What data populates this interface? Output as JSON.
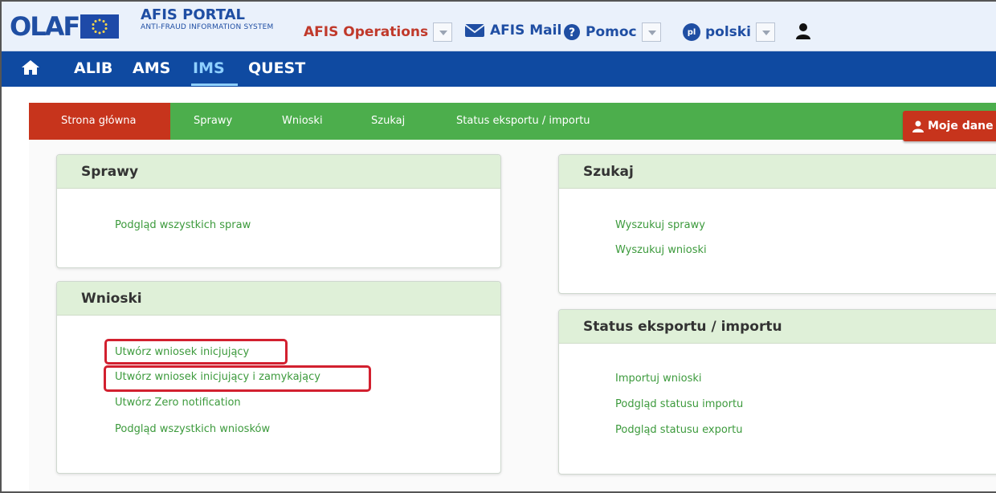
{
  "header": {
    "logo": "OLAF",
    "portal_title": "AFIS PORTAL",
    "portal_subtitle": "ANTI-FRAUD INFORMATION SYSTEM",
    "operations_label": "AFIS Operations",
    "mail_label": "AFIS Mail",
    "help_label": "Pomoc",
    "language_code": "pl",
    "language_label": "polski"
  },
  "app_nav": {
    "items": [
      "ALIB",
      "AMS",
      "IMS",
      "QUEST"
    ],
    "active": "IMS"
  },
  "module_nav": {
    "tabs": [
      "Strona główna",
      "Sprawy",
      "Wnioski",
      "Szukaj",
      "Status eksportu / importu"
    ],
    "active": "Strona główna",
    "user_button": "Moje dane"
  },
  "panels": {
    "sprawy": {
      "title": "Sprawy",
      "links": [
        "Podgląd wszystkich spraw"
      ]
    },
    "wnioski": {
      "title": "Wnioski",
      "links": [
        "Utwórz wniosek inicjujący",
        "Utwórz wniosek inicjujący i zamykający",
        "Utwórz Zero notification",
        "Podgląd wszystkich wniosków"
      ]
    },
    "szukaj": {
      "title": "Szukaj",
      "links": [
        "Wyszukuj sprawy",
        "Wyszukuj wnioski"
      ]
    },
    "status": {
      "title": "Status eksportu / importu",
      "links": [
        "Importuj wnioski",
        "Podgląd statusu importu",
        "Podgląd statusu exportu"
      ]
    }
  },
  "colors": {
    "brand_blue": "#0f4aa1",
    "nav_green": "#4cae4c",
    "active_red": "#c7341c",
    "link_green": "#3c9a3c",
    "panel_head_green": "#dff0d8",
    "highlight_red": "#d2202f",
    "operations_red": "#c0392b"
  },
  "icons": {
    "home": "home-icon",
    "mail": "envelope-icon",
    "help": "question-circle-icon",
    "user": "user-icon"
  }
}
